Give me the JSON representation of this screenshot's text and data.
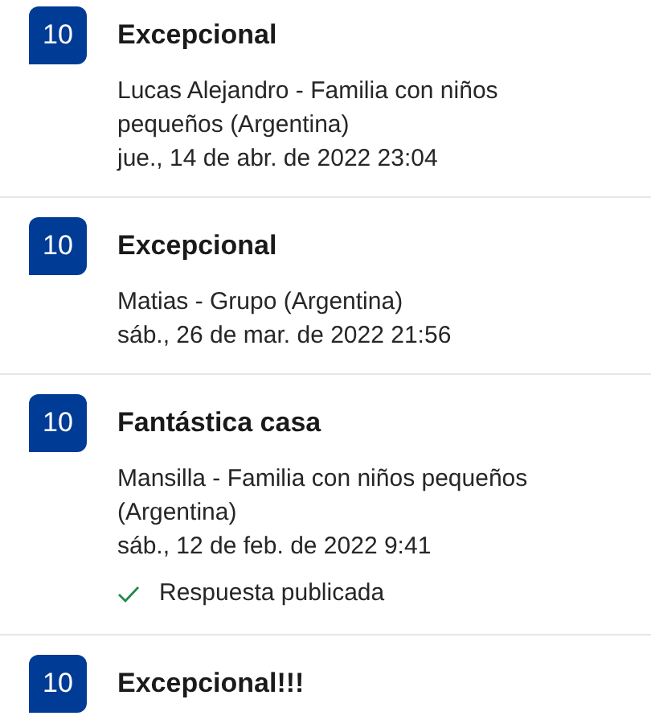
{
  "reviews": [
    {
      "score": "10",
      "title": "Excepcional",
      "author": "Lucas Alejandro - Familia con niños pequeños (Argentina)",
      "date": "jue., 14 de abr. de 2022 23:04"
    },
    {
      "score": "10",
      "title": "Excepcional",
      "author": "Matias - Grupo (Argentina)",
      "date": "sáb., 26 de mar. de 2022 21:56"
    },
    {
      "score": "10",
      "title": "Fantástica casa",
      "author": "Mansilla - Familia con niños pequeños (Argentina)",
      "date": "sáb., 12 de feb. de 2022 9:41",
      "response": "Respuesta publicada"
    },
    {
      "score": "10",
      "title": "Excepcional!!!"
    }
  ]
}
